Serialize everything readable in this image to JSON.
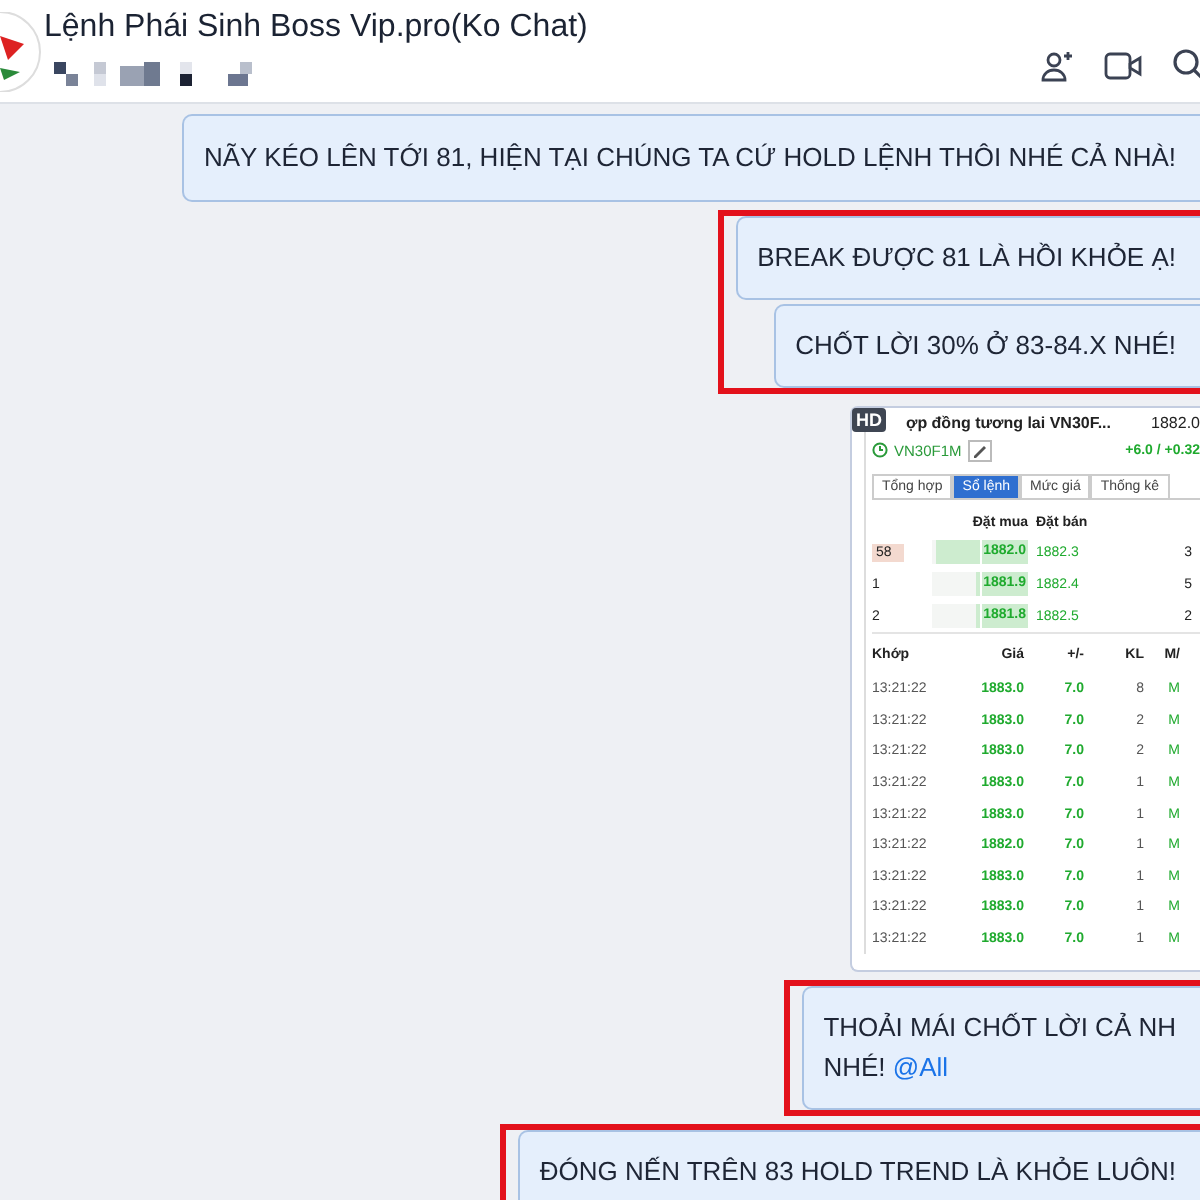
{
  "header": {
    "title": "Lệnh Phái Sinh Boss Vip.pro(Ko Chat)"
  },
  "groups": [
    {
      "highlighted": false,
      "messages": [
        {
          "kind": "text",
          "lines": [
            "NÃY KÉO LÊN TỚI 81, HIỆN TẠI CHÚNG TA CỨ HOLD LỆNH THÔI NHÉ CẢ NHÀ!"
          ]
        }
      ]
    },
    {
      "highlighted": true,
      "messages": [
        {
          "kind": "text",
          "lines": [
            "BREAK ĐƯỢC 81 LÀ HỒI KHỎE Ạ!"
          ]
        },
        {
          "kind": "text",
          "lines": [
            "CHỐT LỜI 30% Ở 83-84.X NHÉ!"
          ]
        }
      ]
    },
    {
      "highlighted": false,
      "messages": [
        {
          "kind": "image",
          "badge": "HD",
          "screen": {
            "title": "ợp đồng tương lai VN30F...",
            "price": "1882.0",
            "symbol": "VN30F1M",
            "change": "+6.0 / +0.32",
            "tabs": [
              {
                "label": "Tổng hợp",
                "selected": false
              },
              {
                "label": "Sổ lệnh",
                "selected": true
              },
              {
                "label": "Mức giá",
                "selected": false
              },
              {
                "label": "Thống kê",
                "selected": false
              }
            ],
            "book_headers": [
              "Đặt mua",
              "Đặt bán"
            ],
            "book": [
              {
                "qty": "58",
                "bid": "1882.0",
                "ask": "1882.3",
                "ask_qty": "3",
                "level": 0.9
              },
              {
                "qty": "1",
                "bid": "1881.9",
                "ask": "1882.4",
                "ask_qty": "5",
                "level": 0.05
              },
              {
                "qty": "2",
                "bid": "1881.8",
                "ask": "1882.5",
                "ask_qty": "2",
                "level": 0.05
              }
            ],
            "trade_headers": [
              "Khớp",
              "Giá",
              "+/-",
              "KL",
              "M/"
            ],
            "trades": [
              {
                "time": "13:21:22",
                "price": "1883.0",
                "change": "7.0",
                "volume": "8",
                "side": "M"
              },
              {
                "time": "13:21:22",
                "price": "1883.0",
                "change": "7.0",
                "volume": "2",
                "side": "M"
              },
              {
                "time": "13:21:22",
                "price": "1883.0",
                "change": "7.0",
                "volume": "2",
                "side": "M"
              },
              {
                "time": "13:21:22",
                "price": "1883.0",
                "change": "7.0",
                "volume": "1",
                "side": "M"
              },
              {
                "time": "13:21:22",
                "price": "1883.0",
                "change": "7.0",
                "volume": "1",
                "side": "M"
              },
              {
                "time": "13:21:22",
                "price": "1882.0",
                "change": "7.0",
                "volume": "1",
                "side": "M"
              },
              {
                "time": "13:21:22",
                "price": "1883.0",
                "change": "7.0",
                "volume": "1",
                "side": "M"
              },
              {
                "time": "13:21:22",
                "price": "1883.0",
                "change": "7.0",
                "volume": "1",
                "side": "M"
              },
              {
                "time": "13:21:22",
                "price": "1883.0",
                "change": "7.0",
                "volume": "1",
                "side": "M"
              }
            ]
          }
        }
      ]
    },
    {
      "highlighted": true,
      "messages": [
        {
          "kind": "text",
          "lines": [
            "THOẢI MÁI CHỐT LỜI CẢ NH",
            "NHÉ!"
          ],
          "mention": "@All"
        }
      ]
    },
    {
      "highlighted": true,
      "messages": [
        {
          "kind": "text",
          "lines": [
            "ĐÓNG NẾN TRÊN 83 HOLD TREND LÀ KHỎE LUÔN!"
          ]
        }
      ]
    }
  ]
}
